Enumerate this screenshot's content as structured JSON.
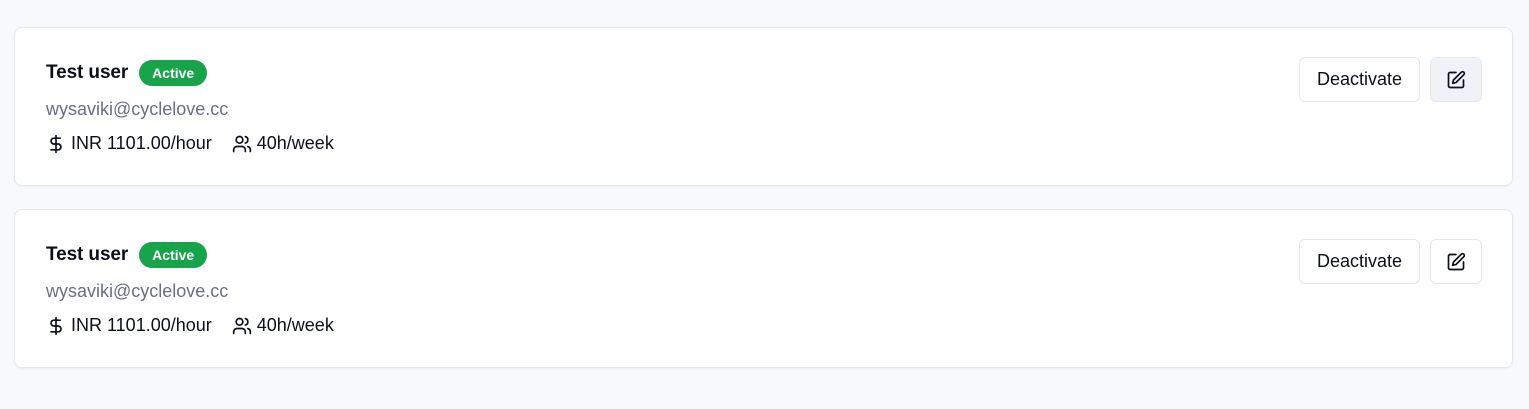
{
  "users": [
    {
      "name": "Test user",
      "status": "Active",
      "email": "wysaviki@cyclelove.cc",
      "rate": "INR 1101.00/hour",
      "hours": "40h/week",
      "deactivate_label": "Deactivate"
    },
    {
      "name": "Test user",
      "status": "Active",
      "email": "wysaviki@cyclelove.cc",
      "rate": "INR 1101.00/hour",
      "hours": "40h/week",
      "deactivate_label": "Deactivate"
    }
  ],
  "icons": {
    "rate": "dollar-icon",
    "hours": "users-icon",
    "edit": "edit-icon"
  },
  "colors": {
    "badge_active": "#16a34a",
    "email_text": "#667085",
    "page_background": "#f8f9fb",
    "edit_button_hover": "#eff2f6"
  }
}
